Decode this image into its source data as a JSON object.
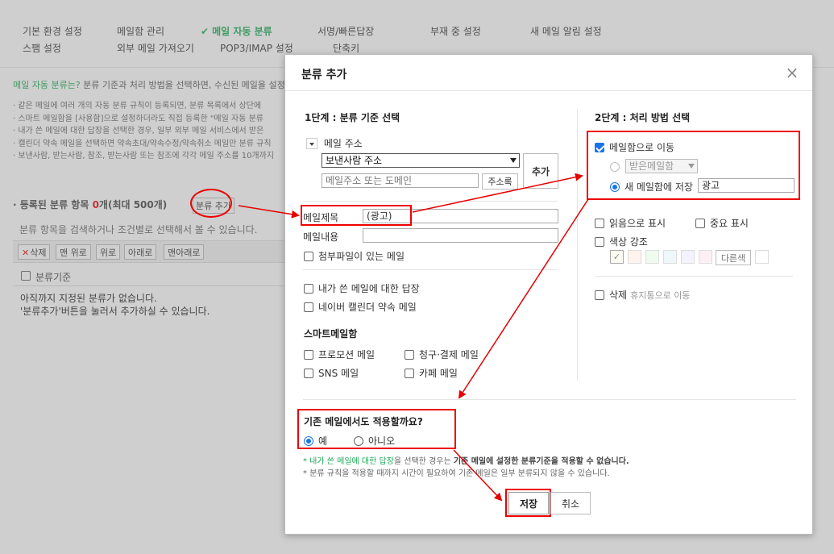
{
  "nav": {
    "row1": [
      "기본 환경 설정",
      "메일함 관리",
      "메일 자동 분류",
      "서명/빠른답장",
      "부재 중 설정",
      "새 메일 알림 설정"
    ],
    "row2": [
      "스팸 설정",
      "외부 메일 가져오기",
      "POP3/IMAP 설정",
      "단축키"
    ],
    "active_check": "✔"
  },
  "background": {
    "intro_highlight": "메일 자동 분류는?",
    "intro_text": " 분류 기준과 처리 방법을 선택하면, 수신된 메일을 설정된",
    "bullets": [
      "· 같은 메일에 여러 개의 자동 분류 규칙이 등록되면, 분류 목록에서 상단에",
      "· 스마트 메일함을 [사용함]으로 설정하더라도 직접 등록한 \"메일 자동 분류",
      "· 내가 쓴 메일에 대한 답장을 선택한 경우, 일부 외부 메일 서비스에서 받은",
      "· 캘린더 약속 메일을 선택하면 약속초대/약속수정/약속취소 메일만 분류 규칙",
      "· 보낸사람, 받는사람, 참조, 받는사람 또는 참조에 각각 메일 주소를 10개까지"
    ],
    "registered_label": "· 등록된 분류 항목 ",
    "registered_count": "0",
    "registered_suffix": "개(최대 500개)",
    "add_category_button": "분류 추가",
    "search_hint": "분류 항목을 검색하거나 조건별로 선택해서 볼 수 있습니다.",
    "toolbar": {
      "delete_x": "✕",
      "delete": "삭제",
      "top": "맨 위로",
      "up": "위로",
      "down": "아래로",
      "bottom": "맨아래로"
    },
    "column_header": "분류기준",
    "empty_line1": "아직까지 지정된 분류가 없습니다.",
    "empty_line2": "'분류추가'버튼을 눌러서 추가하실 수 있습니다."
  },
  "modal": {
    "title": "분류 추가",
    "close_glyph": "×",
    "step1_title": "1단계 : 분류 기준 선택",
    "step2_title": "2단계 : 처리 방법 선택",
    "mail_address_label": "메일 주소",
    "sender_select": "보낸사람 주소",
    "address_placeholder": "메일주소 또는 도메인",
    "address_book_button": "주소록",
    "add_button": "추가",
    "subject_label": "메일제목",
    "subject_value": "(광고)",
    "body_label": "메일내용",
    "body_value": "",
    "attachment_label": "첨부파일이 있는 메일",
    "reply_label": "내가 쓴 메일에 대한 답장",
    "calendar_label": "네이버 캘린더 약속 메일",
    "smart_mailbox_title": "스마트메일함",
    "smart_options": [
      "프로모션 메일",
      "청구·결제 메일",
      "SNS 메일",
      "카페 메일"
    ],
    "move_label": "메일함으로 이동",
    "inbox_option": "받은메일함",
    "new_mailbox_label": "새 메일함에 저장",
    "new_mailbox_value": "광고",
    "mark_read_label": "읽음으로 표시",
    "important_label": "중요 표시",
    "color_label": "색상 강조",
    "color_check": "✓",
    "other_color_button": "다른색",
    "swatch_colors": [
      "#fbfbf3",
      "#fff3ee",
      "#f0fbf0",
      "#eef8fb",
      "#f3f2fd",
      "#fdf0f5"
    ],
    "delete_label": "삭제",
    "delete_sub": "휴지통으로 이동",
    "apply_question": "기존 메일에서도 적용할까요?",
    "yes_label": "예",
    "no_label": "아니오",
    "note1_hl": "* 내가 쓴 메일에 대한 답장",
    "note1_a": "을 선택한 경우는 ",
    "note1_b": "기존 메일에 설정한 분류기준을 적용할 수 없습니다.",
    "note2": "* 분류 규칙을 적용할 때까지 시간이 필요하여 기존 메일은 일부 분류되지 않을 수 있습니다.",
    "save_button": "저장",
    "cancel_button": "취소"
  },
  "annotation_color": "#e60000",
  "accent_color": "#1aaa55"
}
